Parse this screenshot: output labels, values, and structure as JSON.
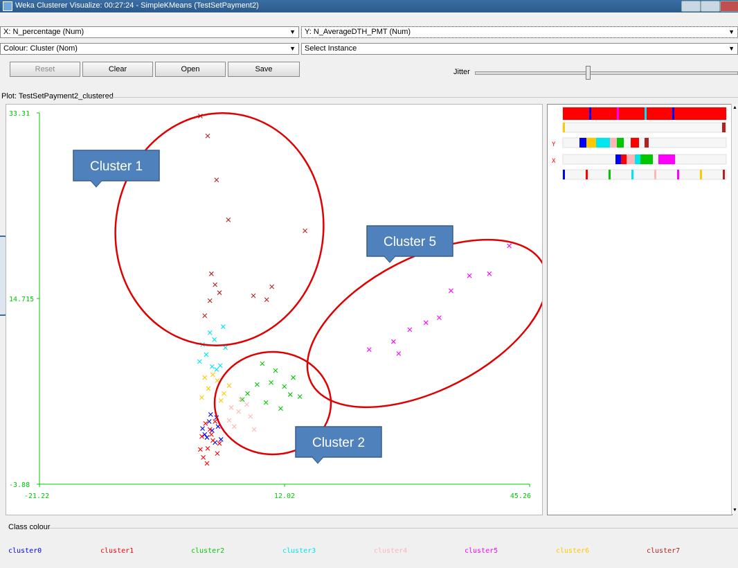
{
  "window": {
    "title": "Weka Clusterer Visualize: 00:27:24 - SimpleKMeans (TestSetPayment2)"
  },
  "controls": {
    "x_axis": "X: N_percentage (Num)",
    "y_axis": "Y: N_AverageDTH_PMT (Num)",
    "colour": "Colour: Cluster (Nom)",
    "instance": "Select Instance",
    "reset": "Reset",
    "clear": "Clear",
    "open": "Open",
    "save": "Save",
    "jitter_label": "Jitter",
    "jitter_level": 0.43
  },
  "plot": {
    "title": "Plot: TestSetPayment2_clustered"
  },
  "class_colour": {
    "label": "Class colour"
  },
  "annotations": {
    "cluster1": "Cluster 1",
    "cluster5": "Cluster 5",
    "cluster2": "Cluster 2"
  },
  "colors": {
    "cluster0": "#0000ff",
    "cluster1": "#ff0000",
    "cluster2": "#00c800",
    "cluster3": "#00e5ee",
    "cluster4": "#ffb6b6",
    "cluster5": "#ff00ff",
    "cluster6": "#ffc800",
    "cluster7": "#b22222",
    "axis": "#00c800",
    "callout": "#4f81bd",
    "ellipse": "#e00000"
  },
  "chart_data": {
    "type": "scatter",
    "title": "",
    "xlabel": "N_percentage",
    "ylabel": "N_AverageDTH_PMT",
    "xlim": [
      -21.22,
      45.26
    ],
    "ylim": [
      -3.88,
      33.31
    ],
    "x_ticks": [
      "-21.22",
      "12.02",
      "45.26"
    ],
    "y_ticks": [
      "-3.88",
      "14.715",
      "33.31"
    ],
    "legend": [
      "cluster0",
      "cluster1",
      "cluster2",
      "cluster3",
      "cluster4",
      "cluster5",
      "cluster6",
      "cluster7"
    ],
    "series": [
      {
        "name": "cluster0",
        "x": [
          1.5,
          2.2,
          1.8,
          2.6,
          3.0,
          1.2,
          2.8,
          3.4,
          0.9,
          2.0
        ],
        "y": [
          0.8,
          1.5,
          2.4,
          0.3,
          1.9,
          1.1,
          2.8,
          0.6,
          1.7,
          3.1
        ]
      },
      {
        "name": "cluster1",
        "x": [
          1.0,
          1.6,
          2.3,
          0.8,
          2.9,
          1.9,
          1.3,
          2.6,
          0.6,
          3.2,
          1.5,
          2.1
        ],
        "y": [
          -1.2,
          -0.3,
          0.5,
          0.9,
          -0.8,
          1.6,
          2.2,
          2.4,
          -0.4,
          0.2,
          -1.8,
          1.1
        ]
      },
      {
        "name": "cluster2",
        "x": [
          7.0,
          8.3,
          9.5,
          10.8,
          12.0,
          13.2,
          14.1,
          9.0,
          11.5,
          6.3,
          10.2,
          12.8
        ],
        "y": [
          5.2,
          6.1,
          4.3,
          7.5,
          5.9,
          6.8,
          4.9,
          8.2,
          3.7,
          4.6,
          6.3,
          5.1
        ]
      },
      {
        "name": "cluster3",
        "x": [
          0.5,
          1.4,
          2.5,
          3.3,
          1.9,
          4.0,
          2.8,
          0.9,
          3.7,
          2.2
        ],
        "y": [
          8.4,
          9.1,
          10.6,
          8.0,
          11.3,
          9.8,
          7.6,
          10.1,
          11.9,
          7.9
        ]
      },
      {
        "name": "cluster4",
        "x": [
          4.5,
          5.8,
          6.9,
          5.2,
          7.4,
          6.1,
          4.8,
          7.9
        ],
        "y": [
          2.5,
          3.4,
          4.1,
          1.9,
          2.9,
          4.6,
          3.8,
          1.6
        ]
      },
      {
        "name": "cluster5",
        "x": [
          23.5,
          26.8,
          29.0,
          31.2,
          34.6,
          37.1,
          39.8,
          42.5,
          27.5,
          33.0
        ],
        "y": [
          9.6,
          10.4,
          11.6,
          12.3,
          15.5,
          17.0,
          17.2,
          20.0,
          9.2,
          12.8
        ]
      },
      {
        "name": "cluster6",
        "x": [
          0.8,
          1.7,
          2.9,
          3.8,
          2.3,
          4.5,
          1.2,
          3.4
        ],
        "y": [
          4.8,
          5.7,
          6.5,
          5.2,
          7.1,
          6.0,
          6.8,
          4.5
        ]
      },
      {
        "name": "cluster7",
        "x": [
          1.2,
          1.9,
          2.6,
          3.2,
          2.1,
          7.8,
          9.6,
          10.3,
          0.6,
          14.8,
          4.4,
          2.8,
          1.6
        ],
        "y": [
          13.0,
          14.5,
          16.1,
          15.3,
          17.2,
          15.0,
          14.6,
          15.9,
          33.0,
          21.5,
          22.6,
          26.6,
          31.0
        ]
      }
    ]
  }
}
